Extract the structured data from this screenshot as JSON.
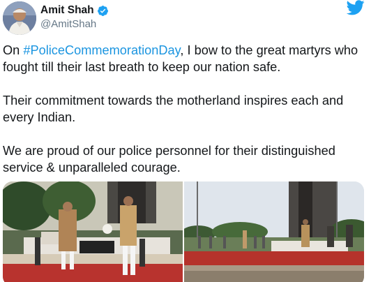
{
  "user": {
    "display_name": "Amit Shah",
    "handle": "@AmitShah",
    "verified": true,
    "avatar_icon": "profile-avatar"
  },
  "header_icon": "twitter-bird-icon",
  "tweet": {
    "line1_prefix": "On ",
    "hashtag": "#PoliceCommemorationDay",
    "line1_suffix": ", I bow to the great martyrs who fought till their last breath to keep our nation safe.",
    "paragraph2": "Their commitment towards the motherland inspires each and every Indian.",
    "paragraph3": "We are proud of our police personnel for their distinguished service & unparalleled courage."
  },
  "colors": {
    "link": "#1b95e0",
    "twitter_blue": "#1da1f2",
    "text": "#14171a",
    "secondary": "#657786"
  },
  "media": {
    "count": 2
  }
}
